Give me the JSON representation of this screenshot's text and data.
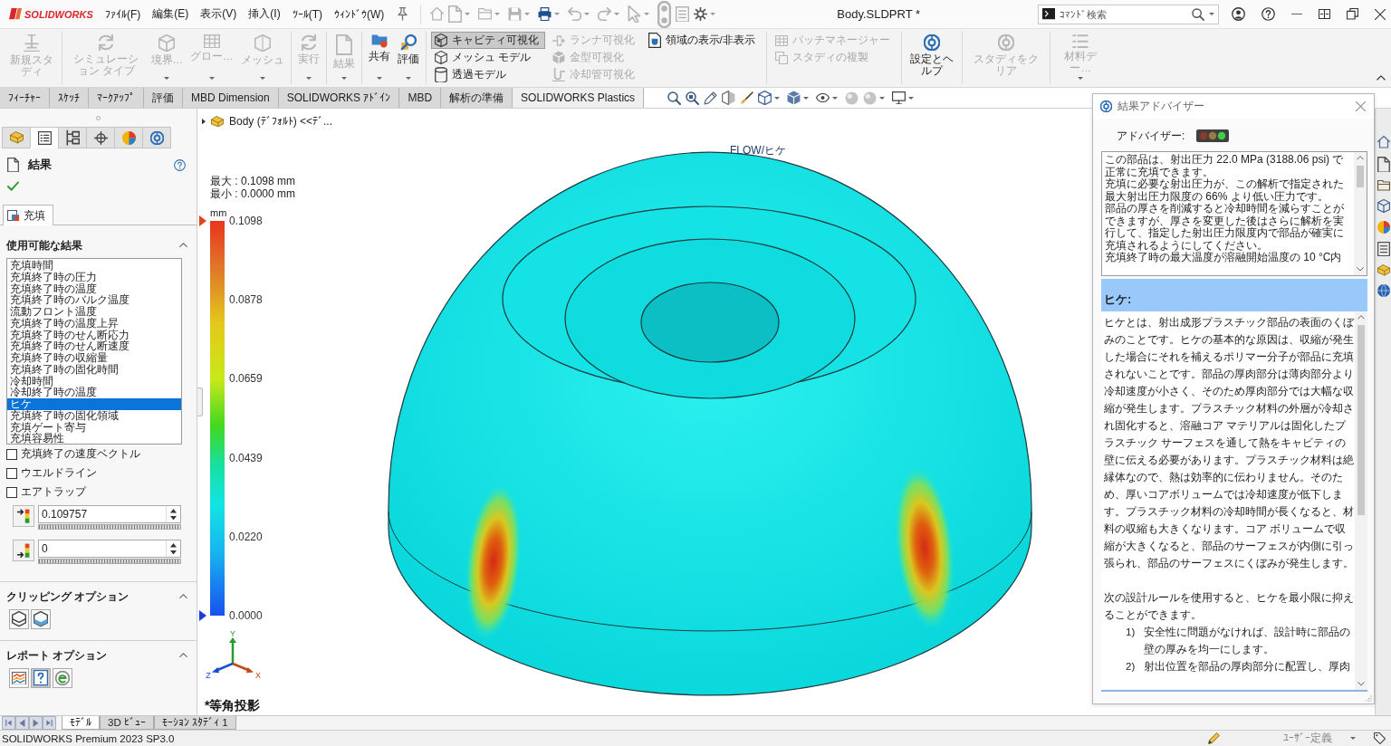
{
  "window": {
    "app_name": "SOLIDWORKS",
    "menu": [
      {
        "label": "ﾌｧｲﾙ(F)"
      },
      {
        "label": "編集(E)"
      },
      {
        "label": "表示(V)"
      },
      {
        "label": "挿入(I)"
      },
      {
        "label": "ﾂｰﾙ(T)"
      },
      {
        "label": "ｳｨﾝﾄﾞｳ(W)"
      }
    ],
    "title": "Body.SLDPRT *",
    "command_search": {
      "placeholder": "ｺﾏﾝﾄﾞ検索"
    }
  },
  "ribbon": [
    {
      "kind": "large",
      "items": [
        {
          "label": "新規スタディ",
          "disabled": true,
          "dropdown": false
        }
      ]
    },
    {
      "kind": "large",
      "items": [
        {
          "label": "シミュレーション タイプ",
          "disabled": true,
          "dropdown": false
        },
        {
          "label": "境界…",
          "disabled": true,
          "dropdown": true
        },
        {
          "label": "グロー…",
          "disabled": true,
          "dropdown": true
        },
        {
          "label": "メッシュ",
          "disabled": true,
          "dropdown": true
        }
      ]
    },
    {
      "kind": "large",
      "items": [
        {
          "label": "実行",
          "disabled": true,
          "dropdown": true
        }
      ]
    },
    {
      "kind": "large",
      "items": [
        {
          "label": "結果",
          "disabled": true,
          "dropdown": true
        }
      ]
    },
    {
      "kind": "large",
      "items": [
        {
          "label": "共有",
          "disabled": false,
          "dropdown": true
        },
        {
          "label": "評価",
          "disabled": false,
          "dropdown": true
        }
      ]
    },
    {
      "kind": "stack",
      "columns": [
        [
          {
            "label": "キャビティ可視化",
            "disabled": false,
            "on": true
          },
          {
            "label": "メッシュ モデル",
            "disabled": false,
            "on": false
          },
          {
            "label": "透過モデル",
            "disabled": false,
            "on": false
          }
        ],
        [
          {
            "label": "ランナ可視化",
            "disabled": true,
            "on": false
          },
          {
            "label": "金型可視化",
            "disabled": true,
            "on": false
          },
          {
            "label": "冷却管可視化",
            "disabled": true,
            "on": false
          }
        ],
        [
          {
            "label": "領域の表示/非表示",
            "disabled": false,
            "on": false
          }
        ]
      ]
    },
    {
      "kind": "stack",
      "columns": [
        [
          {
            "label": "パッチマネージャー",
            "disabled": true,
            "on": false
          },
          {
            "label": "スタディの複製",
            "disabled": true,
            "on": false
          }
        ]
      ]
    },
    {
      "kind": "large",
      "items": [
        {
          "label": "設定とヘルプ",
          "disabled": false,
          "dropdown": false
        }
      ]
    },
    {
      "kind": "large",
      "items": [
        {
          "label": "スタディをクリア",
          "disabled": true,
          "dropdown": false
        }
      ]
    },
    {
      "kind": "large",
      "items": [
        {
          "label": "材料デー…",
          "disabled": true,
          "dropdown": true
        }
      ]
    }
  ],
  "tabs": [
    {
      "label": "ﾌｨｰﾁｬｰ",
      "selected": false
    },
    {
      "label": "ｽｹｯﾁ",
      "selected": false
    },
    {
      "label": "ﾏｰｸｱｯﾌﾟ",
      "selected": false
    },
    {
      "label": "評価",
      "selected": false
    },
    {
      "label": "MBD Dimension",
      "selected": false
    },
    {
      "label": "SOLIDWORKS ｱﾄﾞｲﾝ",
      "selected": false
    },
    {
      "label": "MBD",
      "selected": false
    },
    {
      "label": "解析の準備",
      "selected": false
    },
    {
      "label": "SOLIDWORKS Plastics",
      "selected": true
    }
  ],
  "property_manager": {
    "tabs": [
      {
        "selected": false
      },
      {
        "selected": true
      },
      {
        "selected": false
      },
      {
        "selected": false
      },
      {
        "selected": false
      },
      {
        "selected": false
      }
    ],
    "title": "結果",
    "study_tabs": [
      {
        "label": "充填",
        "selected": true
      }
    ],
    "sections": [
      {
        "kind": "results",
        "title": "使用可能な結果",
        "expanded": true,
        "items": [
          {
            "label": "充填時間",
            "selected": false
          },
          {
            "label": "充填終了時の圧力",
            "selected": false
          },
          {
            "label": "充填終了時の温度",
            "selected": false
          },
          {
            "label": "充填終了時のバルク温度",
            "selected": false
          },
          {
            "label": "流動フロント温度",
            "selected": false
          },
          {
            "label": "充填終了時の温度上昇",
            "selected": false
          },
          {
            "label": "充填終了時のせん断応力",
            "selected": false
          },
          {
            "label": "充填終了時のせん断速度",
            "selected": false
          },
          {
            "label": "充填終了時の収縮量",
            "selected": false
          },
          {
            "label": "充填終了時の固化時間",
            "selected": false
          },
          {
            "label": "冷却時間",
            "selected": false
          },
          {
            "label": "冷却終了時の温度",
            "selected": false
          },
          {
            "label": "ヒケ",
            "selected": true
          },
          {
            "label": "充填終了時の固化領域",
            "selected": false
          },
          {
            "label": "充填ゲート寄与",
            "selected": false
          },
          {
            "label": "充填容易性",
            "selected": false
          }
        ],
        "options": [
          {
            "label": "充填終了の速度ベクトル",
            "checked": false
          },
          {
            "label": "ウエルドライン",
            "checked": false
          },
          {
            "label": "エアトラップ",
            "checked": false
          }
        ],
        "spins": [
          {
            "value": "0.109757"
          },
          {
            "value": "0"
          }
        ]
      },
      {
        "kind": "icons",
        "title": "クリッピング オプション",
        "expanded": true,
        "buttons": [
          {
            "on": false
          },
          {
            "on": false
          }
        ]
      },
      {
        "kind": "icons",
        "title": "レポート オプション",
        "expanded": true,
        "buttons": [
          {
            "on": false
          },
          {
            "on": true
          },
          {
            "on": false
          }
        ]
      }
    ]
  },
  "viewport": {
    "tree_item": "Body (ﾃﾞﾌｫﾙﾄ) <<ﾃﾞ...",
    "plot_title": "FLOW/ヒケ",
    "max_label": "最大 : 0.1098 mm",
    "min_label": "最小 : 0.0000 mm",
    "legend": {
      "unit": "mm",
      "ticks": [
        "0.1098",
        "0.0878",
        "0.0659",
        "0.0439",
        "0.0220",
        "0.0000"
      ]
    },
    "triad": {
      "up": "Y",
      "left": "Z",
      "right": "X"
    },
    "view_name": "*等角投影"
  },
  "advisor": {
    "title": "結果アドバイザー",
    "advisor_label": "アドバイザー:",
    "traffic_light": {
      "lamps": [
        {
          "on": false
        },
        {
          "on": false
        },
        {
          "on": true
        }
      ]
    },
    "summary": [
      "この部品は、射出圧力 22.0 MPa (3188.06 psi) で正常に充填できます。",
      "充填に必要な射出圧力が、この解析で指定された最大射出圧力限度の 66% より低い圧力です。",
      "部品の厚さを削減すると冷却時間を減らすことができますが、厚さを変更した後はさらに解析を実行して、指定した射出圧力限度内で部品が確実に充填されるようにしてください。",
      "充填終了時の最大温度が溶融開始温度の 10 °C内"
    ],
    "topic": "ヒケ:",
    "body": "ヒケとは、射出成形プラスチック部品の表面のくぼみのことです。ヒケの基本的な原因は、収縮が発生した場合にそれを補えるポリマー分子が部品に充填されないことです。部品の厚肉部分は薄肉部分より冷却速度が小さく、そのため厚肉部分では大幅な収縮が発生します。プラスチック材料の外層が冷却され固化すると、溶融コア マテリアルは固化したプラスチック サーフェスを通して熱をキャビティの壁に伝える必要があります。プラスチック材料は絶縁体なので、熱は効率的に伝わりません。そのため、厚いコアボリュームでは冷却速度が低下します。プラスチック材料の冷却時間が長くなると、材料の収縮も大きくなります。コア ボリュームで収縮が大きくなると、部品のサーフェスが内側に引っ張られ、部品のサーフェスにくぼみが発生します。",
    "intro": "次の設計ルールを使用すると、ヒケを最小限に抑えることができます。",
    "rules": [
      {
        "number": "1)",
        "text": "安全性に問題がなければ、設計時に部品の壁の厚みを均一にします。"
      },
      {
        "number": "2)",
        "text": "射出位置を部品の厚肉部分に配置し、厚肉"
      }
    ]
  },
  "bottom_tabs": [
    {
      "label": "ﾓﾃﾞﾙ",
      "selected": true
    },
    {
      "label": "3D ﾋﾞｭｰ",
      "selected": false
    },
    {
      "label": "ﾓｰｼｮﾝ ｽﾀﾃﾞｨ 1",
      "selected": false
    }
  ],
  "status_bar": {
    "product": "SOLIDWORKS Premium 2023 SP3.0",
    "units": "ﾕｰｻﾞｰ定義"
  }
}
